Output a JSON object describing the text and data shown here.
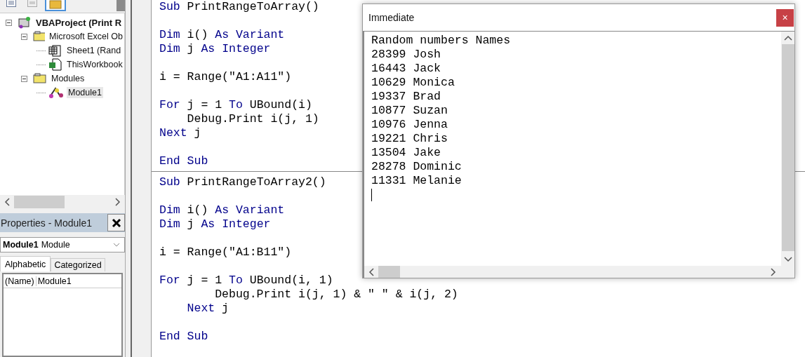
{
  "toolbar": {
    "buttons": [
      {
        "kind": "view-code",
        "selected": false
      },
      {
        "kind": "view-object",
        "selected": false
      },
      {
        "kind": "folder",
        "selected": true
      }
    ]
  },
  "project_tree": [
    {
      "label": "VBAProject (Print R",
      "kind": "project",
      "expanded": true,
      "selected": false,
      "children": [
        {
          "label": "Microsoft Excel Ob",
          "kind": "folder",
          "expanded": true,
          "selected": false,
          "children": [
            {
              "label": "Sheet1 (Rand",
              "kind": "sheet",
              "selected": false
            },
            {
              "label": "ThisWorkbook",
              "kind": "workbook",
              "selected": false
            }
          ]
        },
        {
          "label": "Modules",
          "kind": "folder",
          "expanded": true,
          "selected": false,
          "children": [
            {
              "label": "Module1",
              "kind": "module",
              "selected": true
            }
          ]
        }
      ]
    }
  ],
  "properties": {
    "title": "Properties - Module1",
    "object_name": "Module1",
    "object_type": "Module",
    "tabs": [
      {
        "label": "Alphabetic",
        "selected": true
      },
      {
        "label": "Categorized",
        "selected": false
      }
    ],
    "rows": [
      {
        "name": "(Name)",
        "value": "Module1"
      }
    ]
  },
  "code_blocks": [
    {
      "lines": [
        {
          "kind": "code",
          "segments": [
            {
              "text": "Sub",
              "kind": "keyword"
            },
            {
              "text": " PrintRangeToArray()",
              "kind": "plain"
            }
          ]
        },
        {
          "kind": "blank"
        },
        {
          "kind": "code",
          "segments": [
            {
              "text": "Dim",
              "kind": "keyword"
            },
            {
              "text": " i() ",
              "kind": "plain"
            },
            {
              "text": "As Variant",
              "kind": "keyword"
            }
          ]
        },
        {
          "kind": "code",
          "segments": [
            {
              "text": "Dim",
              "kind": "keyword"
            },
            {
              "text": " j ",
              "kind": "plain"
            },
            {
              "text": "As Integer",
              "kind": "keyword"
            }
          ]
        },
        {
          "kind": "blank"
        },
        {
          "kind": "code",
          "segments": [
            {
              "text": "i = Range(\"A1:A11\")",
              "kind": "plain"
            }
          ]
        },
        {
          "kind": "blank"
        },
        {
          "kind": "code",
          "segments": [
            {
              "text": "For",
              "kind": "keyword"
            },
            {
              "text": " j = 1 ",
              "kind": "plain"
            },
            {
              "text": "To",
              "kind": "keyword"
            },
            {
              "text": " UBound(i)",
              "kind": "plain"
            }
          ]
        },
        {
          "kind": "code",
          "segments": [
            {
              "text": "    Debug.Print i(j, 1)",
              "kind": "plain"
            }
          ]
        },
        {
          "kind": "code",
          "segments": [
            {
              "text": "Next",
              "kind": "keyword"
            },
            {
              "text": " j",
              "kind": "plain"
            }
          ]
        },
        {
          "kind": "blank"
        },
        {
          "kind": "code",
          "segments": [
            {
              "text": "End Sub",
              "kind": "keyword"
            }
          ]
        }
      ]
    },
    {
      "lines": [
        {
          "kind": "code",
          "segments": [
            {
              "text": "Sub",
              "kind": "keyword"
            },
            {
              "text": " PrintRangeToArray2()",
              "kind": "plain"
            }
          ]
        },
        {
          "kind": "blank"
        },
        {
          "kind": "code",
          "segments": [
            {
              "text": "Dim",
              "kind": "keyword"
            },
            {
              "text": " i() ",
              "kind": "plain"
            },
            {
              "text": "As Variant",
              "kind": "keyword"
            }
          ]
        },
        {
          "kind": "code",
          "segments": [
            {
              "text": "Dim",
              "kind": "keyword"
            },
            {
              "text": " j ",
              "kind": "plain"
            },
            {
              "text": "As Integer",
              "kind": "keyword"
            }
          ]
        },
        {
          "kind": "blank"
        },
        {
          "kind": "code",
          "segments": [
            {
              "text": "i = Range(\"A1:B11\")",
              "kind": "plain"
            }
          ]
        },
        {
          "kind": "blank"
        },
        {
          "kind": "code",
          "segments": [
            {
              "text": "For",
              "kind": "keyword"
            },
            {
              "text": " j = 1 ",
              "kind": "plain"
            },
            {
              "text": "To",
              "kind": "keyword"
            },
            {
              "text": " UBound(i, 1)",
              "kind": "plain"
            }
          ]
        },
        {
          "kind": "code",
          "segments": [
            {
              "text": "        Debug.Print i(j, 1) & \" \" & i(j, 2)",
              "kind": "plain"
            }
          ]
        },
        {
          "kind": "code",
          "indented": true,
          "segments": [
            {
              "text": "Next",
              "kind": "keyword"
            },
            {
              "text": " j",
              "kind": "plain"
            }
          ]
        },
        {
          "kind": "blank"
        },
        {
          "kind": "code",
          "segments": [
            {
              "text": "End Sub",
              "kind": "keyword"
            }
          ]
        }
      ]
    }
  ],
  "immediate": {
    "title": "Immediate",
    "close": "×",
    "lines": [
      "Random numbers Names",
      "28399 Josh",
      "16443 Jack",
      "10629 Monica",
      "19337 Brad",
      "10877 Suzan",
      "10976 Jenna",
      "19221 Chris",
      "13504 Jake",
      "28278 Dominic",
      "11331 Melanie"
    ]
  }
}
